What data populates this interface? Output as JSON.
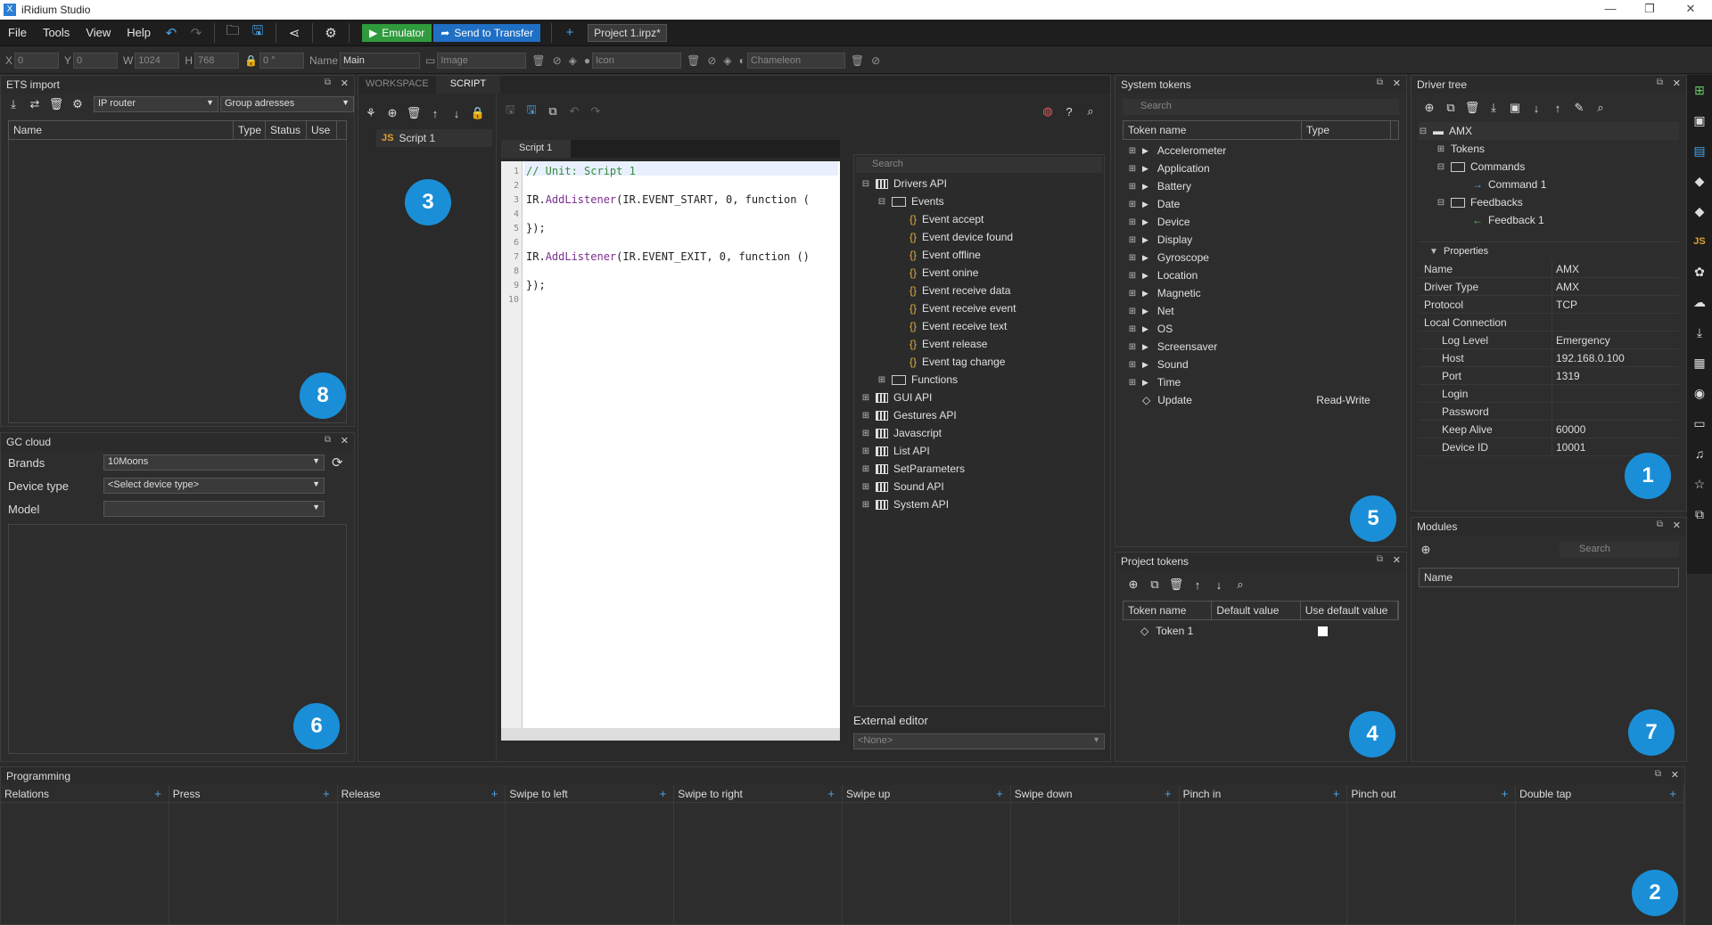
{
  "app": {
    "title": "iRidium Studio",
    "logo_letter": "X"
  },
  "menu": [
    "File",
    "Tools",
    "View",
    "Help"
  ],
  "toolbar": {
    "emulator": "Emulator",
    "send": "Send to Transfer",
    "project_tab": "Project 1.irpz*",
    "plus": "+"
  },
  "propbar": {
    "x_label": "X",
    "x_val": "0",
    "y_label": "Y",
    "y_val": "0",
    "w_label": "W",
    "w_val": "1024",
    "h_label": "H",
    "h_val": "768",
    "angle_val": "0 °",
    "name_label": "Name",
    "name_val": "Main",
    "image_ph": "Image",
    "icon_ph": "Icon",
    "chameleon_ph": "Chameleon"
  },
  "ets": {
    "title": "ETS import",
    "router": "IP router",
    "group": "Group adresses",
    "cols": [
      "Name",
      "Type",
      "Status",
      "Use"
    ]
  },
  "gc": {
    "title": "GC cloud",
    "brands_label": "Brands",
    "brands_val": "10Moons",
    "device_label": "Device type",
    "device_val": "<Select device type>",
    "model_label": "Model"
  },
  "center": {
    "tabs": [
      "WORKSPACE",
      "SCRIPT"
    ],
    "script_item": "Script 1",
    "js": "JS",
    "editor_tab": "Script 1"
  },
  "code": {
    "lines": [
      "1",
      "2",
      "3",
      "4",
      "5",
      "6",
      "7",
      "8",
      "9",
      "10"
    ],
    "l1": "// Unit: Script 1",
    "l3a": "IR.",
    "l3b": "AddListener",
    "l3c": "(IR.EVENT_START, 0, function (",
    "l5": "});",
    "l7a": "IR.",
    "l7b": "AddListener",
    "l7c": "(IR.EVENT_EXIT, 0, function ()",
    "l9": "});"
  },
  "api": {
    "search": "Search",
    "root": "Drivers API",
    "events": "Events",
    "event_items": [
      "Event accept",
      "Event device found",
      "Event offline",
      "Event onine",
      "Event receive data",
      "Event receive event",
      "Event receive text",
      "Event release",
      "Event tag change"
    ],
    "functions": "Functions",
    "others": [
      "GUI API",
      "Gestures API",
      "Javascript",
      "List API",
      "SetParameters",
      "Sound API",
      "System API"
    ],
    "ext_label": "External editor",
    "ext_val": "<None>"
  },
  "sys": {
    "title": "System tokens",
    "search": "Search",
    "col1": "Token name",
    "col2": "Type",
    "items": [
      "Accelerometer",
      "Application",
      "Battery",
      "Date",
      "Device",
      "Display",
      "Gyroscope",
      "Location",
      "Magnetic",
      "Net",
      "OS",
      "Screensaver",
      "Sound",
      "Time"
    ],
    "update": "Update",
    "update_type": "Read-Write"
  },
  "proj": {
    "title": "Project tokens",
    "cols": [
      "Token name",
      "Default value",
      "Use default value"
    ],
    "token": "Token 1"
  },
  "driver": {
    "title": "Driver tree",
    "root": "AMX",
    "tokens": "Tokens",
    "commands": "Commands",
    "command1": "Command 1",
    "feedbacks": "Feedbacks",
    "feedback1": "Feedback 1",
    "props_title": "Properties",
    "props": [
      [
        "Name",
        "AMX"
      ],
      [
        "Driver Type",
        "AMX"
      ],
      [
        "Protocol",
        "TCP"
      ],
      [
        "Local Connection",
        ""
      ]
    ],
    "sub": [
      [
        "Log Level",
        "Emergency"
      ],
      [
        "Host",
        "192.168.0.100"
      ],
      [
        "Port",
        "1319"
      ],
      [
        "Login",
        ""
      ],
      [
        "Password",
        ""
      ],
      [
        "Keep Alive",
        "60000"
      ],
      [
        "Device ID",
        "10001"
      ]
    ]
  },
  "modules": {
    "title": "Modules",
    "search": "Search",
    "col": "Name"
  },
  "prog": {
    "title": "Programming",
    "cols": [
      "Relations",
      "Press",
      "Release",
      "Swipe to left",
      "Swipe to right",
      "Swipe up",
      "Swipe down",
      "Pinch in",
      "Pinch out",
      "Double tap"
    ]
  },
  "badges": [
    "1",
    "2",
    "3",
    "4",
    "5",
    "6",
    "7",
    "8"
  ],
  "icons": [
    "undo-icon",
    "redo-icon",
    "folder-icon",
    "save-icon",
    "share-icon",
    "gear-icon"
  ]
}
